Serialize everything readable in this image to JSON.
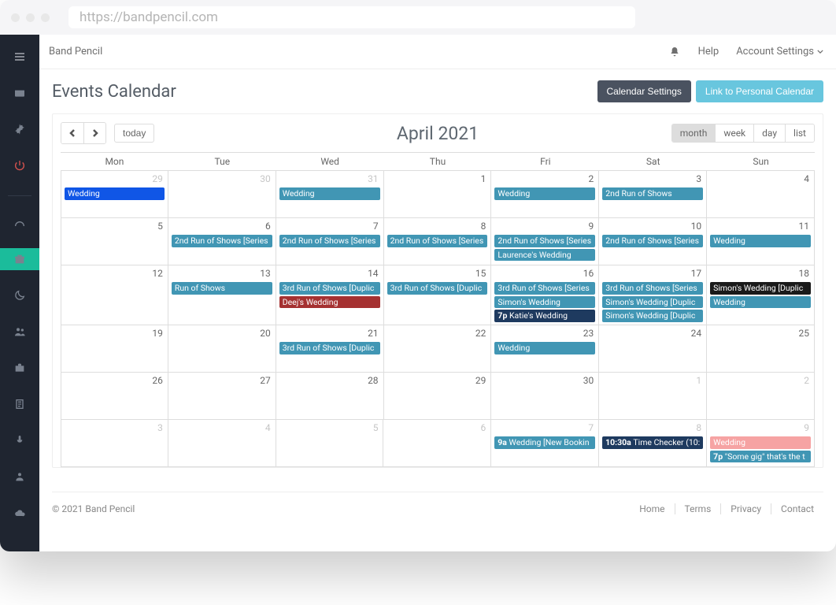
{
  "browser": {
    "url": "https://bandpencil.com"
  },
  "brand": "Band Pencil",
  "topbar": {
    "help": "Help",
    "account": "Account Settings"
  },
  "page": {
    "title": "Events Calendar",
    "settings_btn": "Calendar Settings",
    "link_btn": "Link to Personal Calendar"
  },
  "calendar": {
    "title": "April 2021",
    "today_btn": "today",
    "views": [
      "month",
      "week",
      "day",
      "list"
    ],
    "active_view": "month",
    "days": [
      "Mon",
      "Tue",
      "Wed",
      "Thu",
      "Fri",
      "Sat",
      "Sun"
    ]
  },
  "colors": {
    "teal": "#4196b4",
    "blue": "#1056e6",
    "darknavy": "#1e3a5f",
    "red": "#a53131",
    "black": "#1a1a1a",
    "pink": "#f6a3a3"
  },
  "weeks": [
    [
      {
        "n": 29,
        "out": true,
        "events": [
          {
            "label": "Wedding",
            "c": "blue"
          }
        ]
      },
      {
        "n": 30,
        "out": true,
        "events": []
      },
      {
        "n": 31,
        "out": true,
        "events": [
          {
            "label": "Wedding",
            "c": "teal"
          }
        ]
      },
      {
        "n": 1,
        "events": []
      },
      {
        "n": 2,
        "events": [
          {
            "label": "Wedding",
            "c": "teal"
          }
        ]
      },
      {
        "n": 3,
        "events": [
          {
            "label": "2nd Run of Shows",
            "c": "teal"
          }
        ]
      },
      {
        "n": 4,
        "events": []
      }
    ],
    [
      {
        "n": 5,
        "events": []
      },
      {
        "n": 6,
        "events": [
          {
            "label": "2nd Run of Shows [Series",
            "c": "teal"
          }
        ]
      },
      {
        "n": 7,
        "events": [
          {
            "label": "2nd Run of Shows [Series",
            "c": "teal"
          }
        ]
      },
      {
        "n": 8,
        "events": [
          {
            "label": "2nd Run of Shows [Series",
            "c": "teal"
          }
        ]
      },
      {
        "n": 9,
        "events": [
          {
            "label": "2nd Run of Shows [Series",
            "c": "teal"
          },
          {
            "label": "Laurence's Wedding",
            "c": "teal"
          }
        ]
      },
      {
        "n": 10,
        "events": [
          {
            "label": "2nd Run of Shows [Series",
            "c": "teal"
          }
        ]
      },
      {
        "n": 11,
        "events": [
          {
            "label": "Wedding",
            "c": "teal"
          }
        ]
      }
    ],
    [
      {
        "n": 12,
        "events": []
      },
      {
        "n": 13,
        "events": [
          {
            "label": "Run of Shows",
            "c": "teal"
          }
        ]
      },
      {
        "n": 14,
        "events": [
          {
            "label": "3rd Run of Shows [Duplic",
            "c": "teal"
          },
          {
            "label": "Deej's Wedding",
            "c": "red"
          }
        ]
      },
      {
        "n": 15,
        "events": [
          {
            "label": "3rd Run of Shows [Duplic",
            "c": "teal"
          }
        ]
      },
      {
        "n": 16,
        "events": [
          {
            "label": "3rd Run of Shows [Series",
            "c": "teal"
          },
          {
            "label": "Simon's Wedding",
            "c": "teal"
          },
          {
            "time": "7p",
            "label": "Katie's Wedding",
            "c": "darknavy"
          }
        ]
      },
      {
        "n": 17,
        "events": [
          {
            "label": "3rd Run of Shows [Series",
            "c": "teal"
          },
          {
            "label": "Simon's Wedding [Duplic",
            "c": "teal"
          },
          {
            "label": "Simon's Wedding [Duplic",
            "c": "teal"
          }
        ]
      },
      {
        "n": 18,
        "events": [
          {
            "label": "Simon's Wedding [Duplic",
            "c": "black"
          },
          {
            "label": "Wedding",
            "c": "teal"
          }
        ]
      }
    ],
    [
      {
        "n": 19,
        "events": []
      },
      {
        "n": 20,
        "events": []
      },
      {
        "n": 21,
        "events": [
          {
            "label": "3rd Run of Shows [Duplic",
            "c": "teal"
          }
        ]
      },
      {
        "n": 22,
        "events": []
      },
      {
        "n": 23,
        "events": [
          {
            "label": "Wedding",
            "c": "teal"
          }
        ]
      },
      {
        "n": 24,
        "events": []
      },
      {
        "n": 25,
        "events": []
      }
    ],
    [
      {
        "n": 26,
        "events": []
      },
      {
        "n": 27,
        "events": []
      },
      {
        "n": 28,
        "events": []
      },
      {
        "n": 29,
        "events": []
      },
      {
        "n": 30,
        "events": []
      },
      {
        "n": 1,
        "out": true,
        "events": []
      },
      {
        "n": 2,
        "out": true,
        "events": []
      }
    ],
    [
      {
        "n": 3,
        "out": true,
        "events": []
      },
      {
        "n": 4,
        "out": true,
        "events": []
      },
      {
        "n": 5,
        "out": true,
        "events": []
      },
      {
        "n": 6,
        "out": true,
        "events": []
      },
      {
        "n": 7,
        "out": true,
        "events": [
          {
            "time": "9a",
            "label": "Wedding [New Bookin",
            "c": "teal"
          }
        ]
      },
      {
        "n": 8,
        "out": true,
        "events": [
          {
            "time": "10:30a",
            "label": "Time Checker (10:",
            "c": "darknavy"
          }
        ]
      },
      {
        "n": 9,
        "out": true,
        "events": [
          {
            "label": "Wedding",
            "c": "pink"
          },
          {
            "time": "7p",
            "label": "\"Some gig\" that's the t",
            "c": "teal"
          }
        ]
      }
    ]
  ],
  "footer": {
    "copyright": "© 2021 Band Pencil",
    "links": [
      "Home",
      "Terms",
      "Privacy",
      "Contact"
    ]
  }
}
